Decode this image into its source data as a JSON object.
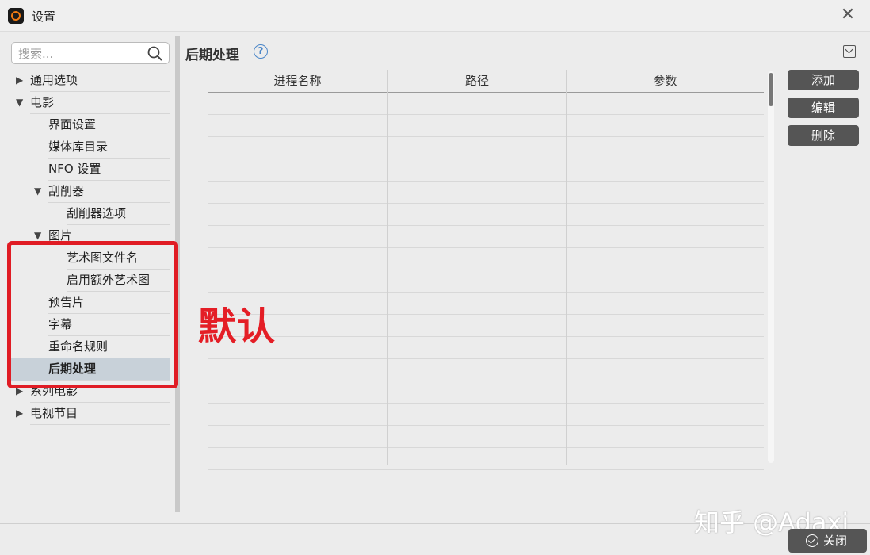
{
  "window": {
    "title": "设置",
    "close_glyph": "✕"
  },
  "search": {
    "placeholder": "搜索..."
  },
  "tree": {
    "items": [
      {
        "label": "通用选项",
        "level": 0,
        "arrow": "▶"
      },
      {
        "label": "电影",
        "level": 0,
        "arrow": "▼"
      },
      {
        "label": "界面设置",
        "level": 1,
        "arrow": ""
      },
      {
        "label": "媒体库目录",
        "level": 1,
        "arrow": ""
      },
      {
        "label": "NFO 设置",
        "level": 1,
        "arrow": ""
      },
      {
        "label": "刮削器",
        "level": 1,
        "arrow": "▼"
      },
      {
        "label": "刮削器选项",
        "level": 2,
        "arrow": ""
      },
      {
        "label": "图片",
        "level": 1,
        "arrow": "▼"
      },
      {
        "label": "艺术图文件名",
        "level": 2,
        "arrow": ""
      },
      {
        "label": "启用额外艺术图",
        "level": 2,
        "arrow": ""
      },
      {
        "label": "预告片",
        "level": 1,
        "arrow": ""
      },
      {
        "label": "字幕",
        "level": 1,
        "arrow": ""
      },
      {
        "label": "重命名规则",
        "level": 1,
        "arrow": ""
      },
      {
        "label": "后期处理",
        "level": 1,
        "arrow": "",
        "selected": true
      },
      {
        "label": "系列电影",
        "level": 0,
        "arrow": "▶"
      },
      {
        "label": "电视节目",
        "level": 0,
        "arrow": "▶"
      }
    ]
  },
  "panel": {
    "title": "后期处理",
    "help_glyph": "?"
  },
  "table": {
    "columns": [
      "进程名称",
      "路径",
      "参数"
    ],
    "rows": [],
    "empty_rows": 17
  },
  "buttons": {
    "add": "添加",
    "edit": "编辑",
    "delete": "删除"
  },
  "annotation": {
    "text": "默认",
    "color": "#e41e26"
  },
  "watermark": {
    "text": "知乎 @Adaxi"
  },
  "footer": {
    "close_label": "关闭"
  }
}
